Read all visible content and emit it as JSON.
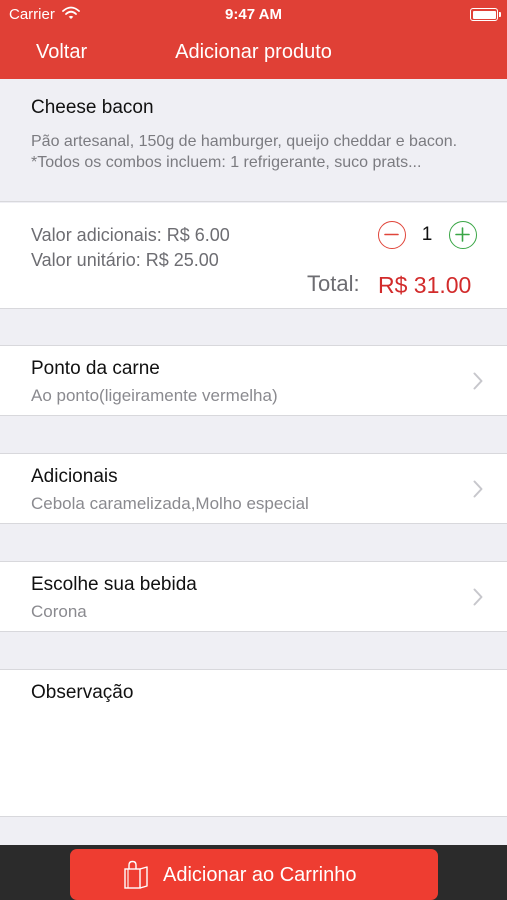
{
  "status_bar": {
    "carrier": "Carrier",
    "time": "9:47 AM",
    "battery_level_percent": 100
  },
  "nav": {
    "back_label": "Voltar",
    "title": "Adicionar produto"
  },
  "product": {
    "name": "Cheese bacon",
    "description": "Pão artesanal, 150g de hamburger, queijo cheddar e bacon.\n*Todos os combos incluem: 1 refrigerante, suco prats..."
  },
  "pricing": {
    "additional_value_text": "Valor adicionais: R$ 6.00",
    "unit_value_text": "Valor unitário: R$ 25.00",
    "quantity": "1",
    "total_label": "Total:",
    "total_value": "R$ 31.00"
  },
  "options": [
    {
      "label": "Ponto da carne",
      "value": "Ao ponto(ligeiramente vermelha)"
    },
    {
      "label": "Adicionais",
      "value": "Cebola caramelizada,Molho especial"
    },
    {
      "label": "Escolhe sua bebida",
      "value": "Corona"
    }
  ],
  "notes": {
    "label": "Observação"
  },
  "cart_button": {
    "label": "Adicionar ao Carrinho"
  },
  "colors": {
    "brand_red": "#e04036",
    "total_red": "#d22b2b",
    "minus_red": "#e0453a",
    "plus_green": "#3aa646",
    "bottom_bar": "#2b2b2b",
    "cart_button": "#ee3d31"
  },
  "icons": {
    "wifi": "wifi-icon",
    "battery": "battery-icon",
    "minus": "minus-circle-icon",
    "plus": "plus-circle-icon",
    "chevron": "chevron-right-icon",
    "bag": "shopping-bag-icon"
  }
}
